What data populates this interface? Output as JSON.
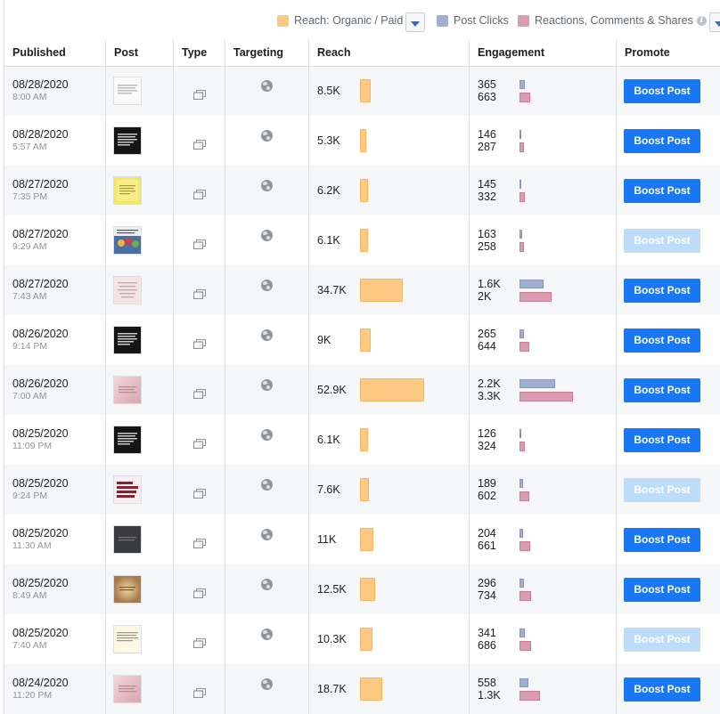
{
  "legend": {
    "reach_label": "Reach: Organic / Paid",
    "clicks_label": "Post Clicks",
    "reactions_label": "Reactions, Comments & Shares",
    "colors": {
      "reach": "#fcc982",
      "clicks": "#a1aecf",
      "reactions": "#d99cb1"
    }
  },
  "columns": {
    "published": "Published",
    "post": "Post",
    "type": "Type",
    "targeting": "Targeting",
    "reach": "Reach",
    "engagement": "Engagement",
    "promote": "Promote"
  },
  "boost_label": "Boost Post",
  "rows": [
    {
      "date": "08/28/2020",
      "time": "8:00 AM",
      "thumb": "white-text",
      "reach": "8.5K",
      "reach_fraction": 0.16,
      "clicks": "365",
      "reactions": "663",
      "clicks_fraction": 0.1,
      "reactions_fraction": 0.2,
      "boost_enabled": true
    },
    {
      "date": "08/28/2020",
      "time": "5:57 AM",
      "thumb": "black-text",
      "reach": "5.3K",
      "reach_fraction": 0.1,
      "clicks": "146",
      "reactions": "287",
      "clicks_fraction": 0.04,
      "reactions_fraction": 0.09,
      "boost_enabled": true
    },
    {
      "date": "08/27/2020",
      "time": "7:35 PM",
      "thumb": "yellow-note",
      "reach": "6.2K",
      "reach_fraction": 0.12,
      "clicks": "145",
      "reactions": "332",
      "clicks_fraction": 0.04,
      "reactions_fraction": 0.1,
      "boost_enabled": true
    },
    {
      "date": "08/27/2020",
      "time": "9:29 AM",
      "thumb": "cartoon",
      "reach": "6.1K",
      "reach_fraction": 0.12,
      "clicks": "163",
      "reactions": "258",
      "clicks_fraction": 0.05,
      "reactions_fraction": 0.08,
      "boost_enabled": false
    },
    {
      "date": "08/27/2020",
      "time": "7:43 AM",
      "thumb": "pink-text",
      "reach": "34.7K",
      "reach_fraction": 0.66,
      "clicks": "1.6K",
      "reactions": "2K",
      "clicks_fraction": 0.45,
      "reactions_fraction": 0.6,
      "boost_enabled": true
    },
    {
      "date": "08/26/2020",
      "time": "9:14 PM",
      "thumb": "black-text",
      "reach": "9K",
      "reach_fraction": 0.17,
      "clicks": "265",
      "reactions": "644",
      "clicks_fraction": 0.08,
      "reactions_fraction": 0.19,
      "boost_enabled": true
    },
    {
      "date": "08/26/2020",
      "time": "7:00 AM",
      "thumb": "pink-gradient",
      "reach": "52.9K",
      "reach_fraction": 1.0,
      "clicks": "2.2K",
      "reactions": "3.3K",
      "clicks_fraction": 0.66,
      "reactions_fraction": 1.0,
      "boost_enabled": true
    },
    {
      "date": "08/25/2020",
      "time": "11:09 PM",
      "thumb": "black-text",
      "reach": "6.1K",
      "reach_fraction": 0.12,
      "clicks": "126",
      "reactions": "324",
      "clicks_fraction": 0.04,
      "reactions_fraction": 0.1,
      "boost_enabled": true
    },
    {
      "date": "08/25/2020",
      "time": "9:24 PM",
      "thumb": "girls-want",
      "thumb_text": "GIRLS WANT ATTENTION. WOMEN WANT RESPECT.",
      "reach": "7.6K",
      "reach_fraction": 0.14,
      "clicks": "189",
      "reactions": "602",
      "clicks_fraction": 0.06,
      "reactions_fraction": 0.18,
      "boost_enabled": false
    },
    {
      "date": "08/25/2020",
      "time": "11:30 AM",
      "thumb": "dark-gray",
      "reach": "11K",
      "reach_fraction": 0.21,
      "clicks": "204",
      "reactions": "661",
      "clicks_fraction": 0.06,
      "reactions_fraction": 0.2,
      "boost_enabled": true
    },
    {
      "date": "08/25/2020",
      "time": "8:49 AM",
      "thumb": "tan-gradient",
      "reach": "12.5K",
      "reach_fraction": 0.24,
      "clicks": "296",
      "reactions": "734",
      "clicks_fraction": 0.09,
      "reactions_fraction": 0.22,
      "boost_enabled": true
    },
    {
      "date": "08/25/2020",
      "time": "7:40 AM",
      "thumb": "cream-text",
      "reach": "10.3K",
      "reach_fraction": 0.19,
      "clicks": "341",
      "reactions": "686",
      "clicks_fraction": 0.1,
      "reactions_fraction": 0.21,
      "boost_enabled": false
    },
    {
      "date": "08/24/2020",
      "time": "11:20 PM",
      "thumb": "pink-gradient",
      "reach": "18.7K",
      "reach_fraction": 0.35,
      "clicks": "558",
      "reactions": "1.3K",
      "clicks_fraction": 0.17,
      "reactions_fraction": 0.39,
      "boost_enabled": true
    }
  ]
}
